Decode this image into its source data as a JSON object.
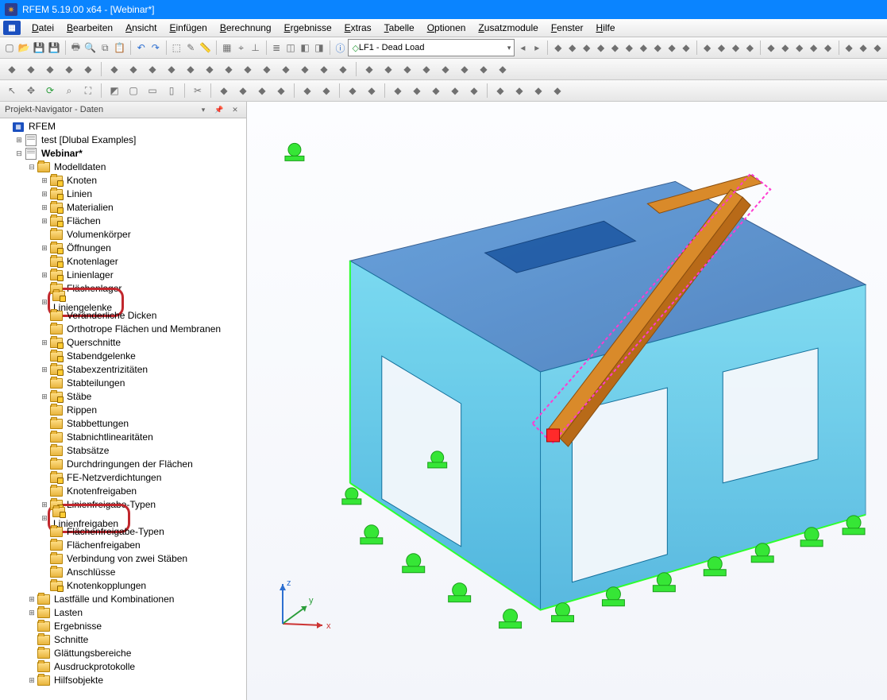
{
  "title": "RFEM 5.19.00 x64 - [Webinar*]",
  "menu": [
    "Datei",
    "Bearbeiten",
    "Ansicht",
    "Einfügen",
    "Berechnung",
    "Ergebnisse",
    "Extras",
    "Tabelle",
    "Optionen",
    "Zusatzmodule",
    "Fenster",
    "Hilfe"
  ],
  "load_case": "LF1 - Dead Load",
  "nav_title": "Projekt-Navigator - Daten",
  "tree": {
    "root": "RFEM",
    "projects": [
      {
        "label": "test [Dlubal Examples]",
        "type": "doc",
        "tw": "+"
      },
      {
        "label": "Webinar*",
        "type": "doc",
        "tw": "-",
        "bold": true,
        "children": [
          {
            "label": "Modelldaten",
            "type": "folder",
            "tw": "-",
            "children": [
              {
                "label": "Knoten",
                "tw": "+",
                "dot": true
              },
              {
                "label": "Linien",
                "tw": "+",
                "dot": true
              },
              {
                "label": "Materialien",
                "tw": "+",
                "dot": true
              },
              {
                "label": "Flächen",
                "tw": "+",
                "dot": true
              },
              {
                "label": "Volumenkörper",
                "tw": "",
                "dot": false
              },
              {
                "label": "Öffnungen",
                "tw": "+",
                "dot": true
              },
              {
                "label": "Knotenlager",
                "tw": "",
                "dot": true
              },
              {
                "label": "Linienlager",
                "tw": "+",
                "dot": true
              },
              {
                "label": "Flächenlager",
                "tw": "",
                "dot": false
              },
              {
                "label": "Liniengelenke",
                "tw": "+",
                "dot": true,
                "hl": true
              },
              {
                "label": "Veränderliche Dicken",
                "tw": "",
                "dot": false
              },
              {
                "label": "Orthotrope Flächen und Membranen",
                "tw": "",
                "dot": false
              },
              {
                "label": "Querschnitte",
                "tw": "+",
                "dot": true
              },
              {
                "label": "Stabendgelenke",
                "tw": "",
                "dot": true
              },
              {
                "label": "Stabexzentrizitäten",
                "tw": "+",
                "dot": true
              },
              {
                "label": "Stabteilungen",
                "tw": "",
                "dot": false
              },
              {
                "label": "Stäbe",
                "tw": "+",
                "dot": true
              },
              {
                "label": "Rippen",
                "tw": "",
                "dot": false
              },
              {
                "label": "Stabbettungen",
                "tw": "",
                "dot": false
              },
              {
                "label": "Stabnichtlinearitäten",
                "tw": "",
                "dot": false
              },
              {
                "label": "Stabsätze",
                "tw": "",
                "dot": false
              },
              {
                "label": "Durchdringungen der Flächen",
                "tw": "",
                "dot": false
              },
              {
                "label": "FE-Netzverdichtungen",
                "tw": "",
                "dot": true
              },
              {
                "label": "Knotenfreigaben",
                "tw": "",
                "dot": false
              },
              {
                "label": "Linienfreigabe-Typen",
                "tw": "+",
                "dot": true
              },
              {
                "label": "Linienfreigaben",
                "tw": "+",
                "dot": true,
                "hl": true
              },
              {
                "label": "Flächenfreigabe-Typen",
                "tw": "",
                "dot": false
              },
              {
                "label": "Flächenfreigaben",
                "tw": "",
                "dot": false
              },
              {
                "label": "Verbindung von zwei Stäben",
                "tw": "",
                "dot": false
              },
              {
                "label": "Anschlüsse",
                "tw": "",
                "dot": false
              },
              {
                "label": "Knotenkopplungen",
                "tw": "",
                "dot": true
              }
            ]
          },
          {
            "label": "Lastfälle und Kombinationen",
            "type": "folder",
            "tw": "+"
          },
          {
            "label": "Lasten",
            "type": "folder",
            "tw": "+"
          },
          {
            "label": "Ergebnisse",
            "type": "folder",
            "tw": ""
          },
          {
            "label": "Schnitte",
            "type": "folder",
            "tw": ""
          },
          {
            "label": "Glättungsbereiche",
            "type": "folder",
            "tw": ""
          },
          {
            "label": "Ausdruckprotokolle",
            "type": "folder",
            "tw": ""
          },
          {
            "label": "Hilfsobjekte",
            "type": "folder",
            "tw": "+"
          }
        ]
      }
    ]
  },
  "axis": {
    "x": "x",
    "y": "y",
    "z": "z"
  },
  "toolbar1": [
    "new",
    "open",
    "save",
    "saveall",
    "",
    "print",
    "preview",
    "copy",
    "paste",
    "",
    "undo",
    "redo",
    "",
    "select",
    "edit",
    "measure",
    "",
    "grid",
    "snap",
    "ortho",
    "",
    "layers",
    "views",
    "win1",
    "win2",
    "",
    "info"
  ],
  "toolbar1b": [
    "arr-l",
    "arr-r",
    "",
    "t1",
    "t2",
    "t3",
    "t4",
    "t5",
    "t6",
    "t7",
    "t8",
    "t9",
    "t10",
    "",
    "t11",
    "t12",
    "t13",
    "t14",
    "",
    "t15",
    "t16",
    "t17",
    "t18",
    "t19",
    "",
    "t20",
    "t21",
    "t22"
  ],
  "toolbar2": [
    "a",
    "b",
    "c",
    "d",
    "e",
    "",
    "f",
    "g",
    "h",
    "i",
    "j",
    "k",
    "l",
    "m",
    "n",
    "o",
    "p",
    "q",
    "r",
    "",
    "s",
    "t",
    "u",
    "v",
    "w",
    "x",
    "y",
    "z"
  ],
  "toolbar3": [
    "cursor",
    "pan",
    "orbit",
    "zoomwin",
    "zoomall",
    "",
    "iso",
    "top",
    "front",
    "side",
    "",
    "cut",
    "",
    "sec1",
    "sec2",
    "sec3",
    "sec4",
    "",
    "lay1",
    "lay2",
    "",
    "view1",
    "view2",
    "",
    "ren1",
    "ren2",
    "ren3",
    "ren4",
    "ren5",
    "",
    "ax1",
    "ax2",
    "ax3",
    "ax4"
  ]
}
